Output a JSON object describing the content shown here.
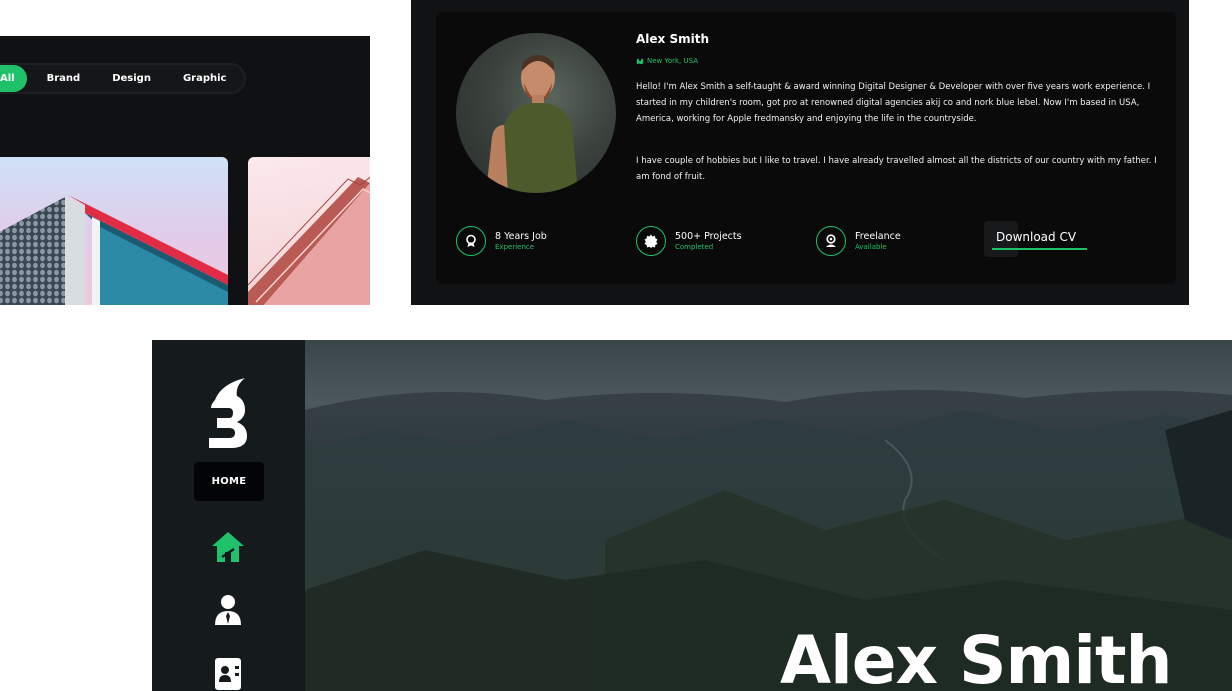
{
  "portfolio": {
    "filters": [
      "All",
      "Brand",
      "Design",
      "Graphic"
    ],
    "active_filter": "All"
  },
  "about": {
    "name": "Alex Smith",
    "location": "New York, USA",
    "bio_1": "Hello! I'm Alex Smith a self-taught & award winning Digital Designer & Developer with over five years work experience. I started in my children's room, got pro at renowned digital agencies akij co and nork blue lebel. Now I'm based in USA, America, working for Apple fredmansky and enjoying the life in the countryside.",
    "bio_2": "I have couple of hobbies but I like to travel. I have already travelled almost all the districts of our country with my father. I am fond of fruit.",
    "stats": [
      {
        "title": "8 Years Job",
        "subtitle": "Experience",
        "icon": "award-icon"
      },
      {
        "title": "500+ Projects",
        "subtitle": "Completed",
        "icon": "badge-icon"
      },
      {
        "title": "Freelance",
        "subtitle": "Available",
        "icon": "medal-icon"
      }
    ],
    "download_label": "Download CV"
  },
  "hero": {
    "nav_label": "HOME",
    "title": "Alex Smith",
    "nav_icons": [
      "home-icon",
      "user-icon",
      "contact-book-icon"
    ],
    "logo": "b-logo-icon"
  },
  "colors": {
    "accent": "#1fc26b",
    "panel": "#0a0a0b",
    "sidebar": "#151a1d"
  }
}
